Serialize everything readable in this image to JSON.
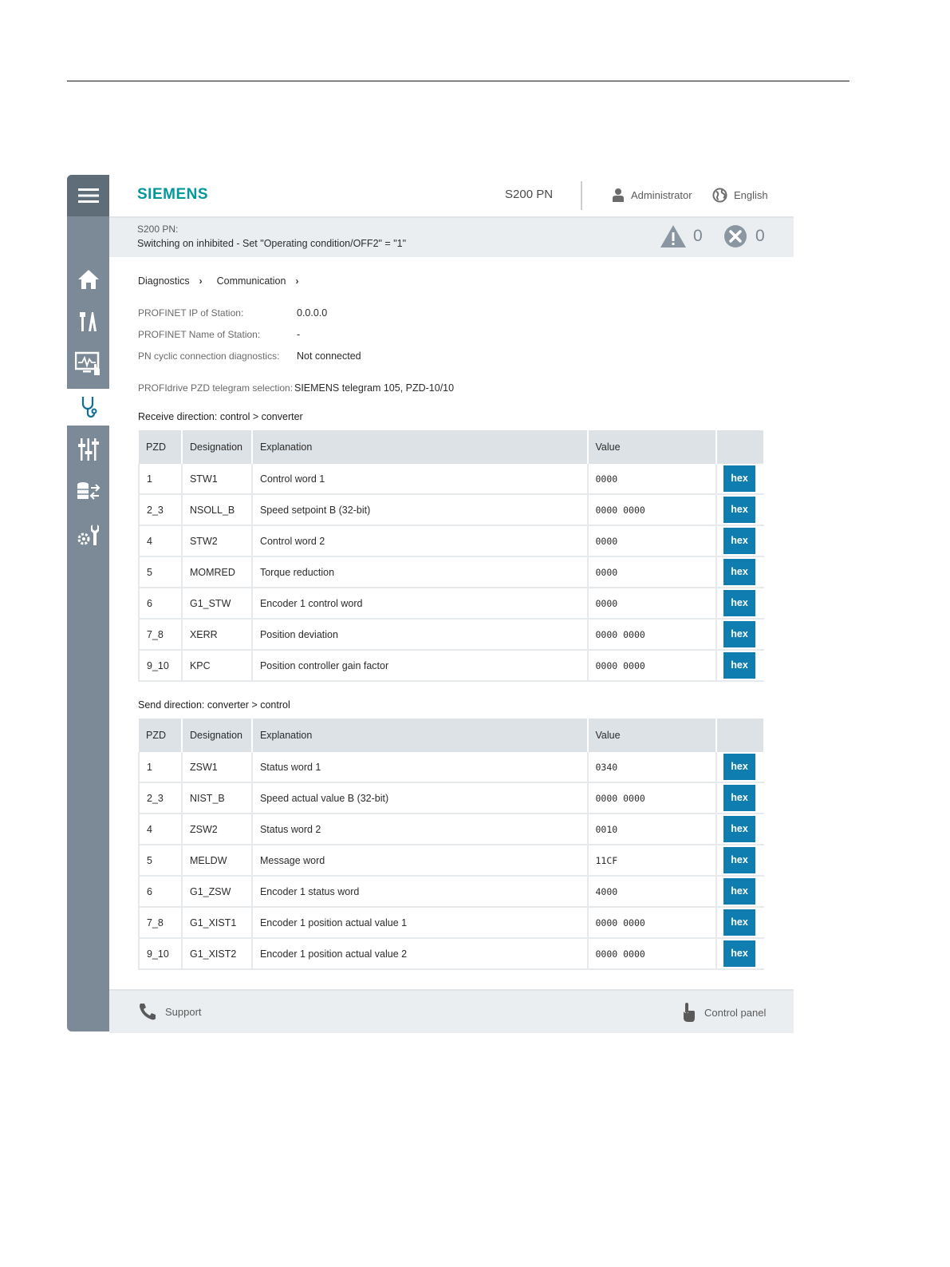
{
  "app": {
    "brand": "SIEMENS",
    "device": "S200 PN",
    "user": "Administrator",
    "language": "English"
  },
  "status": {
    "line1": "S200 PN:",
    "line2": "Switching on inhibited - Set \"Operating condition/OFF2\" = \"1\"",
    "warnings": "0",
    "errors": "0"
  },
  "breadcrumb": [
    "Diagnostics",
    "Communication"
  ],
  "info": [
    {
      "label": "PROFINET IP of Station:",
      "value": "0.0.0.0"
    },
    {
      "label": "PROFINET Name of Station:",
      "value": "-"
    },
    {
      "label": "PN cyclic connection diagnostics:",
      "value": "Not connected"
    }
  ],
  "telegram": {
    "label": "PROFIdrive PZD telegram selection:",
    "value": "SIEMENS telegram 105, PZD-10/10"
  },
  "headers": {
    "pzd": "PZD",
    "designation": "Designation",
    "explanation": "Explanation",
    "value": "Value"
  },
  "receive": {
    "title": "Receive direction: control > converter",
    "rows": [
      {
        "pzd": "1",
        "designation": "STW1",
        "explanation": "Control word 1",
        "value": "0000",
        "btn": "hex"
      },
      {
        "pzd": "2_3",
        "designation": "NSOLL_B",
        "explanation": "Speed setpoint B (32-bit)",
        "value": "0000 0000",
        "btn": "hex"
      },
      {
        "pzd": "4",
        "designation": "STW2",
        "explanation": "Control word 2",
        "value": "0000",
        "btn": "hex"
      },
      {
        "pzd": "5",
        "designation": "MOMRED",
        "explanation": "Torque reduction",
        "value": "0000",
        "btn": "hex"
      },
      {
        "pzd": "6",
        "designation": "G1_STW",
        "explanation": "Encoder 1 control word",
        "value": "0000",
        "btn": "hex"
      },
      {
        "pzd": "7_8",
        "designation": "XERR",
        "explanation": "Position deviation",
        "value": "0000 0000",
        "btn": "hex"
      },
      {
        "pzd": "9_10",
        "designation": "KPC",
        "explanation": "Position controller gain factor",
        "value": "0000 0000",
        "btn": "hex"
      }
    ]
  },
  "send": {
    "title": "Send direction: converter > control",
    "rows": [
      {
        "pzd": "1",
        "designation": "ZSW1",
        "explanation": "Status word 1",
        "value": "0340",
        "btn": "hex"
      },
      {
        "pzd": "2_3",
        "designation": "NIST_B",
        "explanation": "Speed actual value B (32-bit)",
        "value": "0000 0000",
        "btn": "hex"
      },
      {
        "pzd": "4",
        "designation": "ZSW2",
        "explanation": "Status word 2",
        "value": "0010",
        "btn": "hex"
      },
      {
        "pzd": "5",
        "designation": "MELDW",
        "explanation": "Message word",
        "value": "11CF",
        "btn": "hex"
      },
      {
        "pzd": "6",
        "designation": "G1_ZSW",
        "explanation": "Encoder 1 status word",
        "value": "4000",
        "btn": "hex"
      },
      {
        "pzd": "7_8",
        "designation": "G1_XIST1",
        "explanation": "Encoder 1 position actual value 1",
        "value": "0000 0000",
        "btn": "hex"
      },
      {
        "pzd": "9_10",
        "designation": "G1_XIST2",
        "explanation": "Encoder 1 position actual value 2",
        "value": "0000 0000",
        "btn": "hex"
      }
    ]
  },
  "footer": {
    "support": "Support",
    "control_panel": "Control panel"
  },
  "colors": {
    "brand": "#009999",
    "sidebar": "#7c8a97",
    "hex_button": "#0f7db0"
  },
  "icons": [
    "menu-icon",
    "home-icon",
    "tools-icon",
    "monitor-icon",
    "stethoscope-icon",
    "sliders-icon",
    "database-transfer-icon",
    "settings-wrench-icon",
    "user-icon",
    "globe-icon",
    "warning-icon",
    "error-icon",
    "phone-icon",
    "hand-pointer-icon"
  ]
}
